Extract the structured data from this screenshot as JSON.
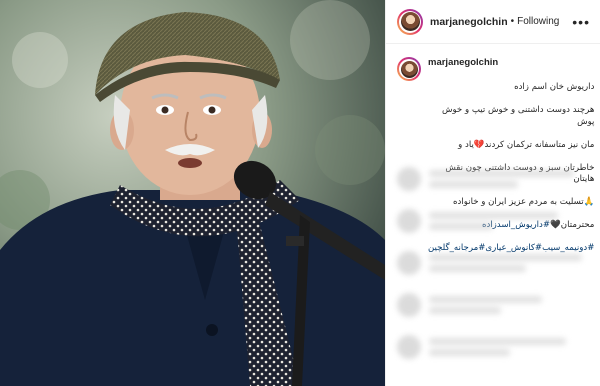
{
  "post": {
    "image_alt_icon": "photo-icon"
  },
  "header": {
    "username": "marjanegolchin",
    "separator": "•",
    "follow_status": "Following",
    "more_icon": "more-options-icon",
    "more_label": "•••"
  },
  "caption": {
    "username": "marjanegolchin",
    "line1": "داریوش خان اسم زاده",
    "line2": "هرچند دوست داشتنی و خوش تیپ و خوش پوش",
    "line3": "مان نیز متاسفانه ترکمان کردند💔یاد و",
    "line4": "خاطرتان سبز و دوست داشتنی چون نقش هایتان",
    "line5": "🙏تسلیت به مردم عزیز ایران و خانواده",
    "line6": "محترمتان🖤",
    "tags_line1": "#داریوش_اسدزاده",
    "tags_line2": "#دونیمه_سیب#کانوش_عیاری#مرجانه_گلچین"
  },
  "colors": {
    "tag": "#00376b",
    "text": "#262626",
    "border": "#efefef"
  }
}
